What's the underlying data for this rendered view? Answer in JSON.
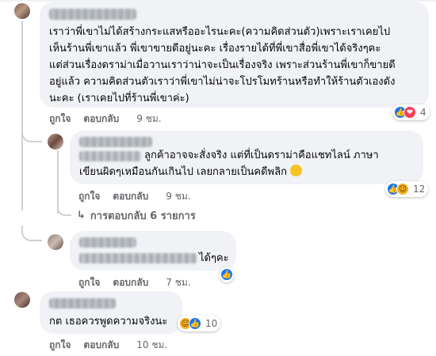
{
  "comments": [
    {
      "text_lines": [
        "เราว่าพี่เขาไม่ได้สร้างกระแสหรืออะไรนะคะ(ความคิดส่วนตัว)เพราะเราเคยไป",
        "เห็นร้านพี่เขาแล้ว พี่เขาขายดีอยู่นะคะ เรื่องรายได้ที่พี่เขาสื่อพี่เขาได้จริงๆคะ",
        "แต่ส่วนเรื่องดราม่าเมื่อวานเราว่าน่าจะเป็นเรื่องจริง เพราะส่วนร้านพี่เขาก็ขายดี",
        "อยู่แล้ว ความคิดส่วนตัวเราว่าพี่เขาไม่น่าจะโปรโมทร้านหรือทำให้ร้านตัวเองดัง",
        "นะคะ (เราเคยไปที่ร้านพี่เขาค่ะ)"
      ],
      "like": "ถูกใจ",
      "reply": "ตอบกลับ",
      "time": "9 ชม.",
      "reaction_count": "4"
    },
    {
      "text_line1": "ลูกค้าอาจจะสั่งจริง แต่ที่เป็นดราม่าคือแชทไลน์ ภาษา",
      "text_line2": "เขียนผิดๆเหมือนกันเกินไป เลยกลายเป็นคดีพลิก",
      "like": "ถูกใจ",
      "reply": "ตอบกลับ",
      "time": "9 ชม.",
      "reaction_count": "12",
      "view_replies": "การตอบกลับ 6 รายการ"
    },
    {
      "text_suffix": "ได้ๆคะ",
      "like": "ถูกใจ",
      "reply": "ตอบกลับ",
      "time": "7 ชม."
    },
    {
      "text": "กต เธอควรพูดความจริงนะ",
      "like": "ถูกใจ",
      "reply": "ตอบกลับ",
      "time": "10 ชม.",
      "reaction_count": "10"
    }
  ],
  "icons": {
    "like": "like-icon",
    "love": "love-icon",
    "haha": "haha-icon",
    "reply_arrow": "reply-arrow-icon"
  },
  "colors": {
    "bubble": "#f0f2f5",
    "like_blue": "#1877f2",
    "meta_gray": "#65676b"
  }
}
